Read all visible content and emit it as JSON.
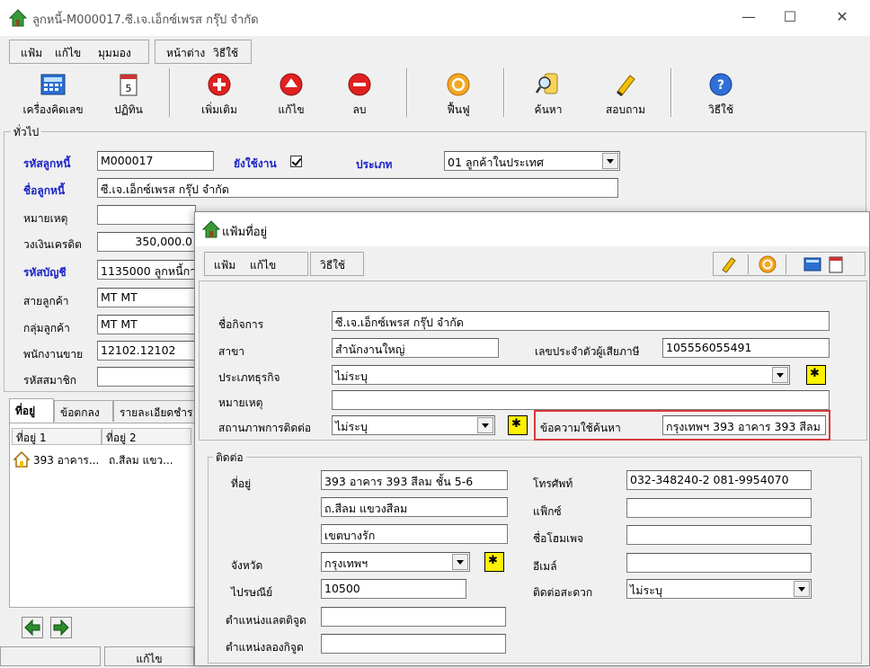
{
  "main": {
    "title": "ลูกหนี้-M000017.ซี.เจ.เอ็กซ์เพรส กรุ๊ป จำกัด",
    "menu_group1": [
      "แฟ้ม",
      "แก้ไข",
      "มุมมอง"
    ],
    "menu_group2": [
      "หน้าต่าง",
      "วิธีใช้"
    ],
    "toolbar": {
      "calculator": "เครื่องคิดเลข",
      "calendar": "ปฏิทิน",
      "add": "เพิ่มเติม",
      "edit": "แก้ไข",
      "delete": "ลบ",
      "restore": "ฟื้นฟู",
      "search": "ค้นหา",
      "inquire": "สอบถาม",
      "help": "วิธีใช้"
    },
    "general_group_title": "ทั่วไป",
    "fields": {
      "debtor_code_label": "รหัสลูกหนี้",
      "debtor_code_value": "M000017",
      "in_use_label": "ยังใช้งาน",
      "type_label": "ประเภท",
      "type_value": "01 ลูกค้าในประเทศ",
      "debtor_name_label": "ชื่อลูกหนี้",
      "debtor_name_value": "ซี.เจ.เอ็กซ์เพรส กรุ๊ป จำกัด",
      "note_label": "หมายเหตุ",
      "note_value": "",
      "credit_limit_label": "วงเงินเครดิต",
      "credit_limit_value": "350,000.0",
      "account_code_label": "รหัสบัญชี",
      "account_code_value": "1135000 ลูกหนี้กา",
      "customer_line_label": "สายลูกค้า",
      "customer_line_value": "MT MT",
      "customer_group_label": "กลุ่มลูกค้า",
      "customer_group_value": "MT MT",
      "salesperson_label": "พนักงานขาย",
      "salesperson_value": "12102.12102",
      "member_code_label": "รหัสสมาชิก",
      "member_code_value": ""
    },
    "tabs": [
      "ที่อยู่",
      "ข้อตกลง",
      "รายละเอียดชำร"
    ],
    "list": {
      "col1": "ที่อยู่ 1",
      "col2": "ที่อยู่ 2",
      "row1_col1": "393 อาคาร...",
      "row1_col2": "ถ.สีลม แขว..."
    },
    "status": {
      "mode": "แก้ไข"
    }
  },
  "dialog": {
    "title": "แฟ้มที่อยู่",
    "menu": [
      "แฟ้ม",
      "แก้ไข"
    ],
    "menu_help": "วิธีใช้",
    "business_name_label": "ชื่อกิจการ",
    "business_name_value": "ซี.เจ.เอ็กซ์เพรส กรุ๊ป จำกัด",
    "branch_label": "สาขา",
    "branch_value": "สำนักงานใหญ่",
    "tax_id_label": "เลขประจำตัวผู้เสียภาษี",
    "tax_id_value": "105556055491",
    "business_type_label": "ประเภทธุรกิจ",
    "business_type_value": "ไม่ระบุ",
    "note_label": "หมายเหตุ",
    "note_value": "",
    "contact_status_label": "สถานภาพการติดต่อ",
    "contact_status_value": "ไม่ระบุ",
    "search_text_label": "ข้อความใช้ค้นหา",
    "search_text_value": "กรุงเทพฯ 393 อาคาร 393 สีลม",
    "contact_group_title": "ติดต่อ",
    "address_label": "ที่อยู่",
    "address_line1": "393 อาคาร 393 สีลม ชั้น 5-6",
    "address_line2": "ถ.สีลม แขวงสีลม",
    "address_line3": "เขตบางรัก",
    "province_label": "จังหวัด",
    "province_value": "กรุงเทพฯ",
    "postcode_label": "ไปรษณีย์",
    "postcode_value": "10500",
    "latitude_label": "ตำแหน่งแลตติจูด",
    "latitude_value": "",
    "longitude_label": "ตำแหน่งลองกิจูด",
    "longitude_value": "",
    "phone_label": "โทรศัพท์",
    "phone_value": "032-348240-2 081-9954070",
    "fax_label": "แฟ็กซ์",
    "fax_value": "",
    "homepage_label": "ชื่อโฮมเพจ",
    "homepage_value": "",
    "email_label": "อีเมล์",
    "email_value": "",
    "convenient_contact_label": "ติดต่อสะดวก",
    "convenient_contact_value": "ไม่ระบุ"
  }
}
